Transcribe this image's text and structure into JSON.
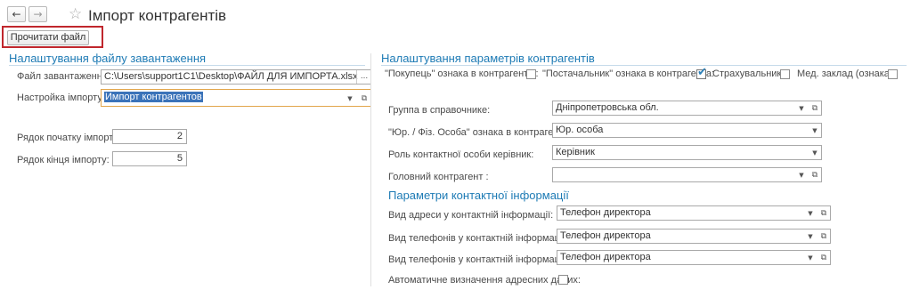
{
  "header": {
    "title": "Імпорт контрагентів",
    "back_icon": "←",
    "forward_icon": "→",
    "star_icon": "☆"
  },
  "toolbar": {
    "read_file_label": "Прочитати файл"
  },
  "left": {
    "section_title": "Налаштування файлу завантаження",
    "file_label": "Файл завантаження:",
    "file_value": "C:\\Users\\support1C1\\Desktop\\ФАЙЛ ДЛЯ ИМПОРТА.xlsx",
    "settings_label": "Настройка імпорту:",
    "settings_value": "Импорт контрагентов",
    "start_row_label": "Рядок початку імпорту:",
    "start_row_value": "2",
    "end_row_label": "Рядок кінця імпорту:",
    "end_row_value": "5"
  },
  "right": {
    "section_title": "Налаштування параметрів контрагентів",
    "buyer_label": "\"Покупець\" ознака в контрагентів:",
    "supplier_label": "\"Постачальник\" ознака в контрагента:",
    "insurer_label": "Страхувальник:",
    "med_label": "Мед. заклад (ознака):",
    "checkboxes": {
      "buyer": false,
      "supplier": true,
      "insurer": false,
      "med": false
    },
    "group_label": "Группа в справочнике:",
    "group_value": "Дніпропетровська обл.",
    "legal_label": "\"Юр. / Фіз. Особа\" ознака в контрагента:",
    "legal_value": "Юр. особа",
    "role_label": "Роль контактної особи керівник:",
    "role_value": "Керівник",
    "main_label": "Головний контрагент :",
    "main_value": "",
    "contact_title": "Параметри контактної інформації",
    "addr_label": "Вид адреси у контактній інформації:",
    "addr_value": "Телефон директора",
    "phone1_label": "Вид телефонів у контактній інформації:",
    "phone1_value": "Телефон директора",
    "phone2_label": "Вид телефонів у контактній інформації:",
    "phone2_value": "Телефон директора",
    "auto_label": "Автоматичне визначення адресних даних:",
    "auto_checked": false
  },
  "glyphs": {
    "dropdown": "▼",
    "open": "⧉",
    "ellipsis": "..."
  }
}
